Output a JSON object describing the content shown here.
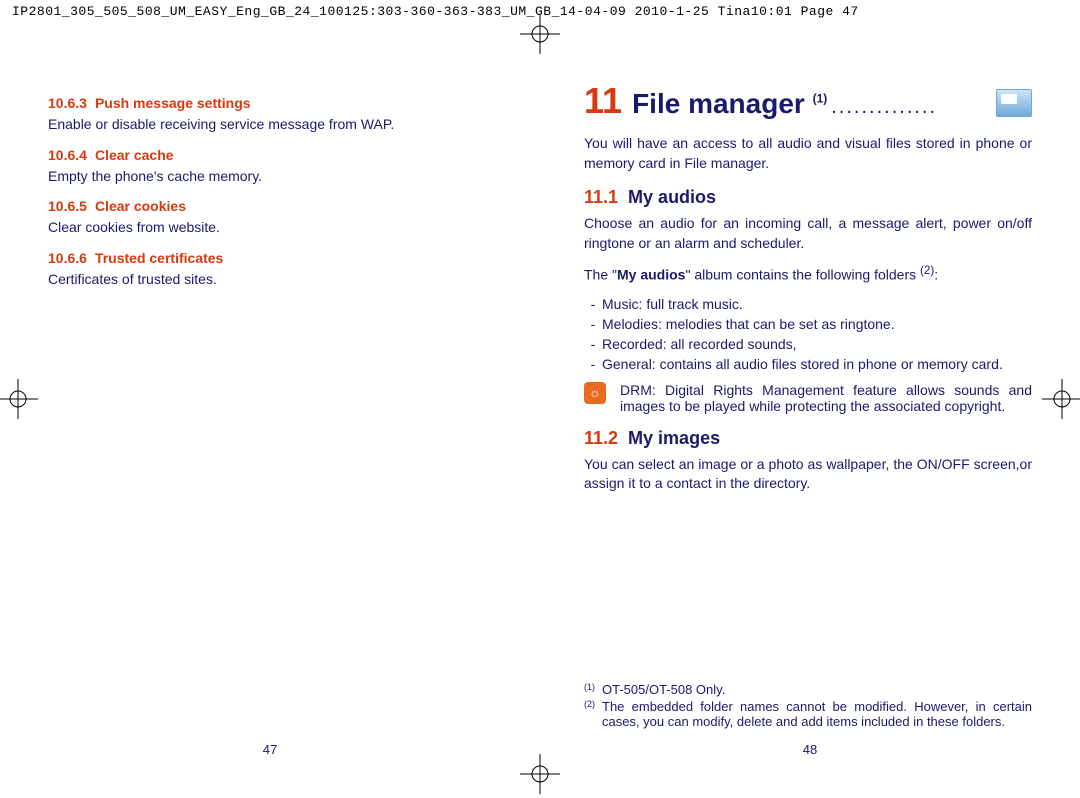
{
  "header": "IP2801_305_505_508_UM_EASY_Eng_GB_24_100125:303-360-363-383_UM_GB_14-04-09  2010-1-25  Tina10:01  Page 47",
  "left": {
    "sections": [
      {
        "num": "10.6.3",
        "title": "Push message settings",
        "body": "Enable or disable receiving service message from WAP."
      },
      {
        "num": "10.6.4",
        "title": "Clear cache",
        "body": "Empty the phone's cache memory."
      },
      {
        "num": "10.6.5",
        "title": "Clear cookies",
        "body": "Clear cookies from website."
      },
      {
        "num": "10.6.6",
        "title": "Trusted certificates",
        "body": "Certificates of trusted sites."
      }
    ],
    "page_num": "47"
  },
  "right": {
    "chapter_num": "11",
    "chapter_title": "File manager",
    "chapter_sup": "(1)",
    "intro": "You will have an access to all audio and visual files stored in phone or memory card in File manager.",
    "sec1": {
      "num": "11.1",
      "title": "My audios",
      "p1": "Choose an audio for an incoming call, a message alert, power on/off ringtone or an alarm and scheduler.",
      "p2_pre": "The \"",
      "p2_bold": "My audios",
      "p2_post": "\" album contains the following folders ",
      "p2_sup": "(2)",
      "p2_end": ":",
      "items": [
        "Music: full track music.",
        "Melodies: melodies that can be set as ringtone.",
        "Recorded: all recorded sounds,",
        "General: contains all audio files stored in phone or memory card."
      ],
      "tip": "DRM: Digital Rights Management feature allows sounds and images to be played while protecting the associated copyright."
    },
    "sec2": {
      "num": "11.2",
      "title": "My images",
      "p1": "You can select an image or a photo as wallpaper, the ON/OFF screen,or assign it to a contact in the directory."
    },
    "footnotes": [
      {
        "sup": "(1)",
        "text": "OT-505/OT-508 Only."
      },
      {
        "sup": "(2)",
        "text": "The embedded folder names cannot be modified. However, in certain cases, you can modify, delete and add items included in these folders."
      }
    ],
    "page_num": "48"
  }
}
